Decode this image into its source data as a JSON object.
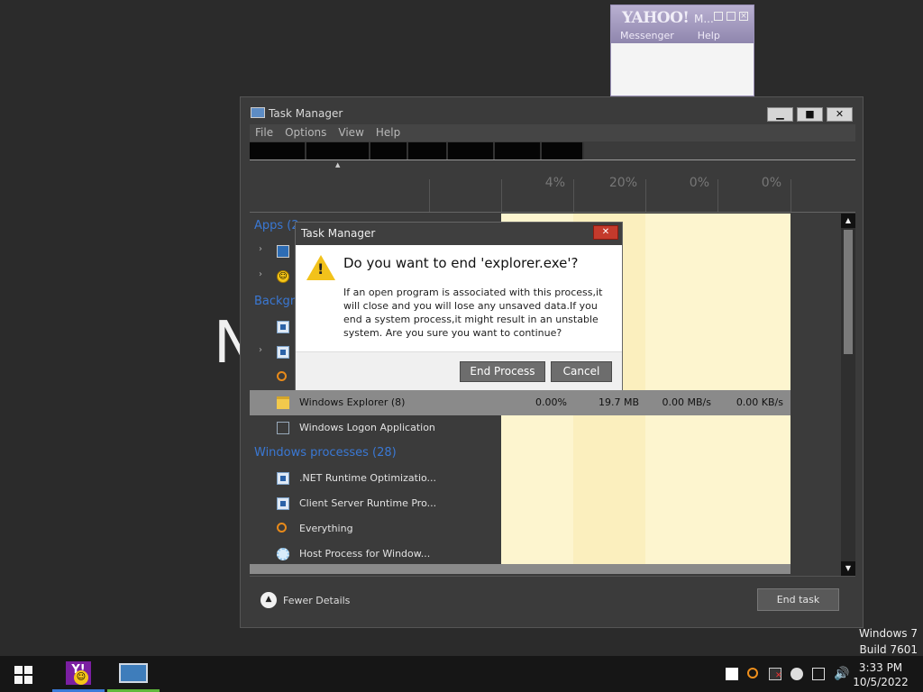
{
  "desktop": {
    "bg_letter": "N",
    "watermark": {
      "line1": "Windows 7",
      "line2": "Build 7601"
    }
  },
  "yahoo": {
    "logo": "YAHOO!",
    "title_rest": "M...",
    "menu": [
      "Messenger",
      "Help"
    ]
  },
  "taskmgr": {
    "title": "Task Manager",
    "menu": [
      "File",
      "Options",
      "View",
      "Help"
    ],
    "columns": {
      "cpu_pct": "4%",
      "mem_pct": "20%",
      "disk_pct": "0%",
      "net_pct": "0%"
    },
    "groups": {
      "apps": "Apps (2",
      "background": "Backgro",
      "windows": "Windows processes (28)"
    },
    "rows": {
      "selected": {
        "name": "Windows Explorer (8)",
        "cpu": "0.00%",
        "mem": "19.7 MB",
        "disk": "0.00 MB/s",
        "net": "0.00 KB/s"
      },
      "logon": {
        "name": "Windows Logon Application"
      },
      "net_runtime": {
        "name": ".NET Runtime Optimizatio..."
      },
      "csrss": {
        "name": "Client Server Runtime Pro..."
      },
      "everything": {
        "name": "Everything"
      },
      "host": {
        "name": "Host Process for Window..."
      }
    },
    "footer": {
      "fewer_details": "Fewer Details",
      "end_task": "End task"
    }
  },
  "dialog": {
    "title": "Task Manager",
    "question": "Do you want to end 'explorer.exe'?",
    "message": "If an open program is associated with this process,it will close and you will lose any unsaved data.If you end a system process,it might result in an unstable system. Are you sure you want to continue?",
    "end_process": "End Process",
    "cancel": "Cancel",
    "close_glyph": "✕"
  },
  "taskbar": {
    "clock_time": "3:33 PM",
    "clock_date": "10/5/2022"
  },
  "colors": {
    "accent_blue": "#3a78d4",
    "heat_yellow": "#fdf5cf",
    "close_red": "#c43a2c"
  }
}
